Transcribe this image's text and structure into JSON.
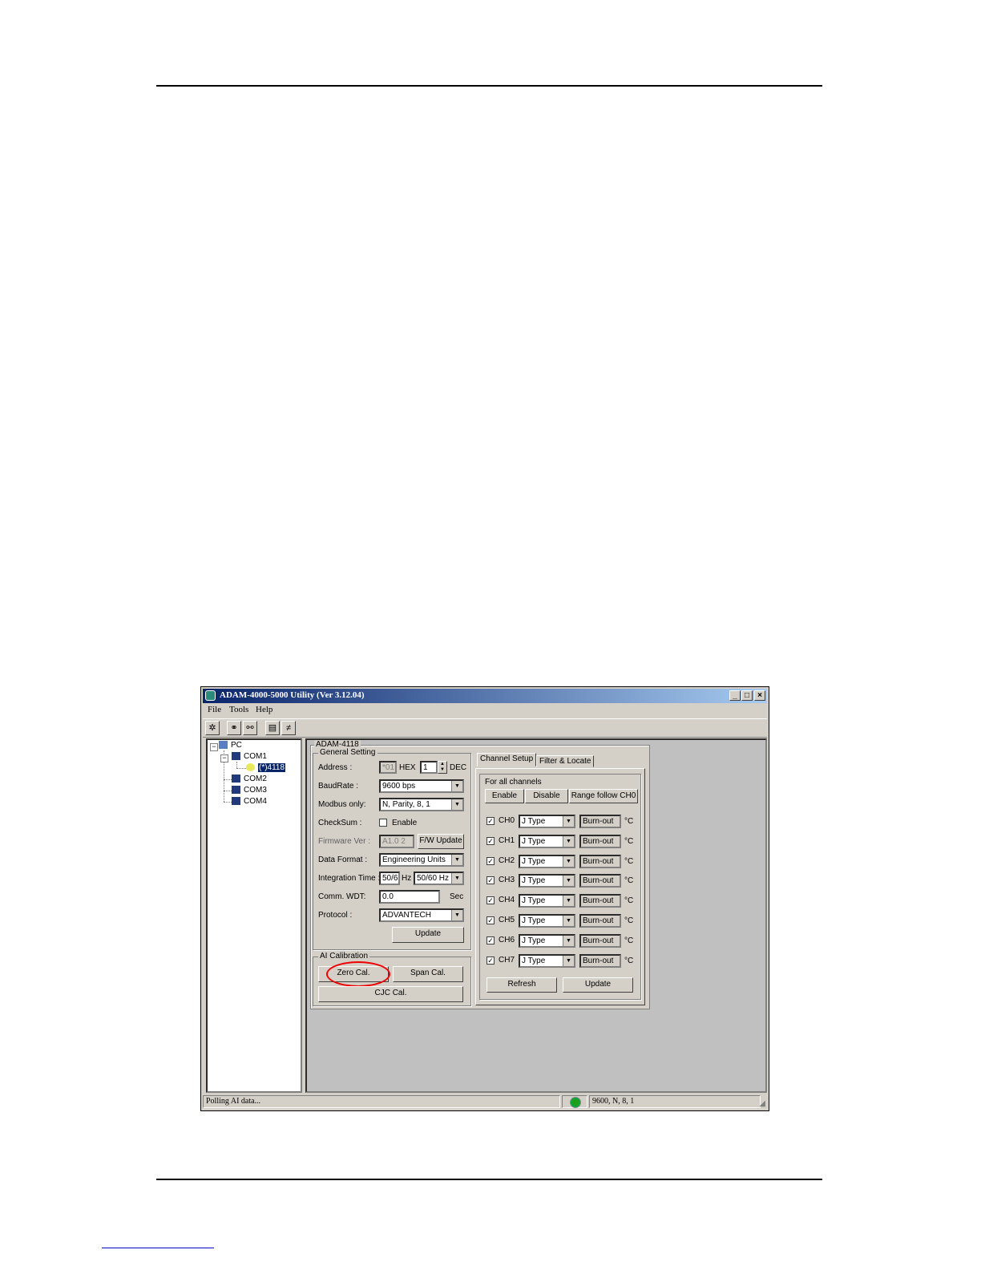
{
  "window": {
    "title": "ADAM-4000-5000 Utility (Ver 3.12.04)",
    "min": "_",
    "max": "□",
    "close": "×"
  },
  "menu": [
    "File",
    "Tools",
    "Help"
  ],
  "tree": {
    "root": "PC",
    "com1": "COM1",
    "module": "(*)4118",
    "com2": "COM2",
    "com3": "COM3",
    "com4": "COM4"
  },
  "module_title": "ADAM-4118",
  "general": {
    "group": "General Setting",
    "address_label": "Address :",
    "address_hex": "*01",
    "hex_label": "HEX",
    "address_dec": "1",
    "dec_label": "DEC",
    "baud_label": "BaudRate :",
    "baud_value": "9600 bps",
    "modbus_label": "Modbus only:",
    "modbus_value": "N, Parity, 8, 1",
    "checksum_label": "CheckSum :",
    "checksum_enable": "Enable",
    "firmware_label": "Firmware Ver :",
    "firmware_value": "A1.0 2",
    "fw_update": "F/W Update",
    "format_label": "Data Format :",
    "format_value": "Engineering Units",
    "integration_label": "Integration Time :",
    "integration_value": "50/6",
    "hz_label": "Hz",
    "integration_select": "50/60 Hz",
    "wdt_label": "Comm. WDT:",
    "wdt_value": "0.0",
    "sec_label": "Sec",
    "protocol_label": "Protocol :",
    "protocol_value": "ADVANTECH",
    "update": "Update"
  },
  "calibration": {
    "group": "AI Calibration",
    "zero": "Zero Cal.",
    "span": "Span Cal.",
    "cjc": "CJC Cal."
  },
  "tabs": [
    "Channel Setup",
    "Filter & Locate"
  ],
  "channel_setup": {
    "all_label": "For all channels",
    "enable": "Enable",
    "disable": "Disable",
    "range_follow": "Range follow CH0",
    "channels": [
      {
        "name": "CH0",
        "type": "J Type",
        "status": "Burn-out",
        "unit": "°C"
      },
      {
        "name": "CH1",
        "type": "J Type",
        "status": "Burn-out",
        "unit": "°C"
      },
      {
        "name": "CH2",
        "type": "J Type",
        "status": "Burn-out",
        "unit": "°C"
      },
      {
        "name": "CH3",
        "type": "J Type",
        "status": "Burn-out",
        "unit": "°C"
      },
      {
        "name": "CH4",
        "type": "J Type",
        "status": "Burn-out",
        "unit": "°C"
      },
      {
        "name": "CH5",
        "type": "J Type",
        "status": "Burn-out",
        "unit": "°C"
      },
      {
        "name": "CH6",
        "type": "J Type",
        "status": "Burn-out",
        "unit": "°C"
      },
      {
        "name": "CH7",
        "type": "J Type",
        "status": "Burn-out",
        "unit": "°C"
      }
    ],
    "refresh": "Refresh",
    "update": "Update"
  },
  "status": {
    "message": "Polling AI data...",
    "comm": "9600, N, 8, 1"
  }
}
